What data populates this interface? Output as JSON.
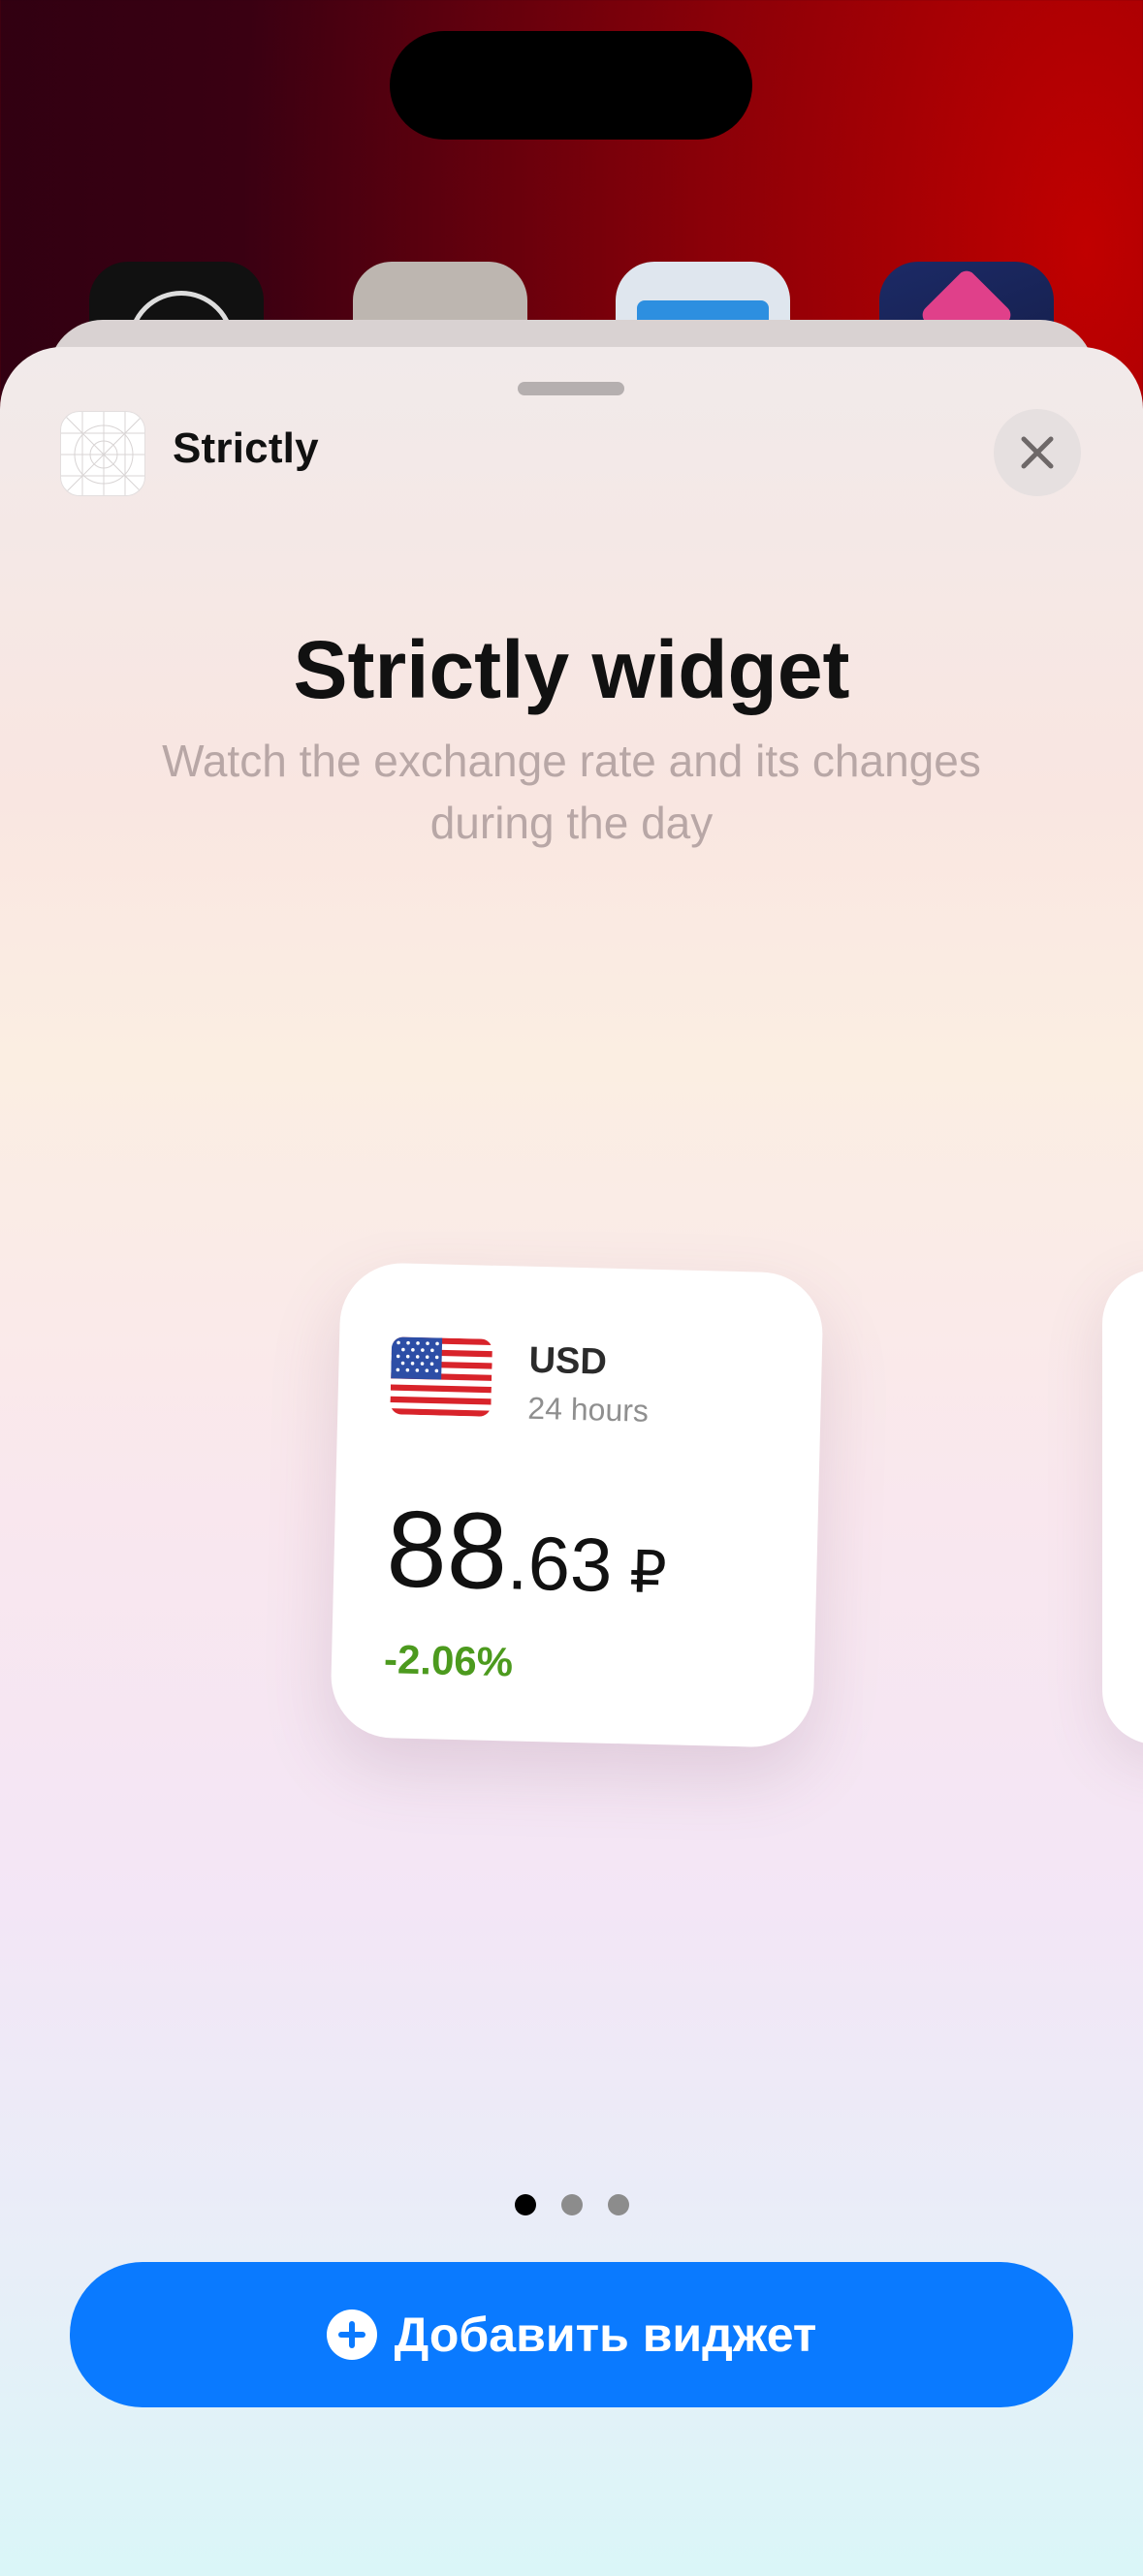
{
  "sheet": {
    "app_name": "Strictly",
    "title": "Strictly widget",
    "subtitle": "Watch the exchange rate and its changes during the day"
  },
  "widget": {
    "currency_code": "USD",
    "period": "24 hours",
    "rate_integer": "88",
    "rate_decimal": ".63",
    "currency_symbol": "₽",
    "change": "-2.06%",
    "change_color": "#4c9a1e"
  },
  "pager": {
    "pages": 3,
    "current": 1
  },
  "add_button": {
    "label": "Добавить виджет",
    "color": "#0a7aff"
  },
  "icons": [
    "close-icon",
    "plus-circle-icon",
    "us-flag-icon"
  ]
}
